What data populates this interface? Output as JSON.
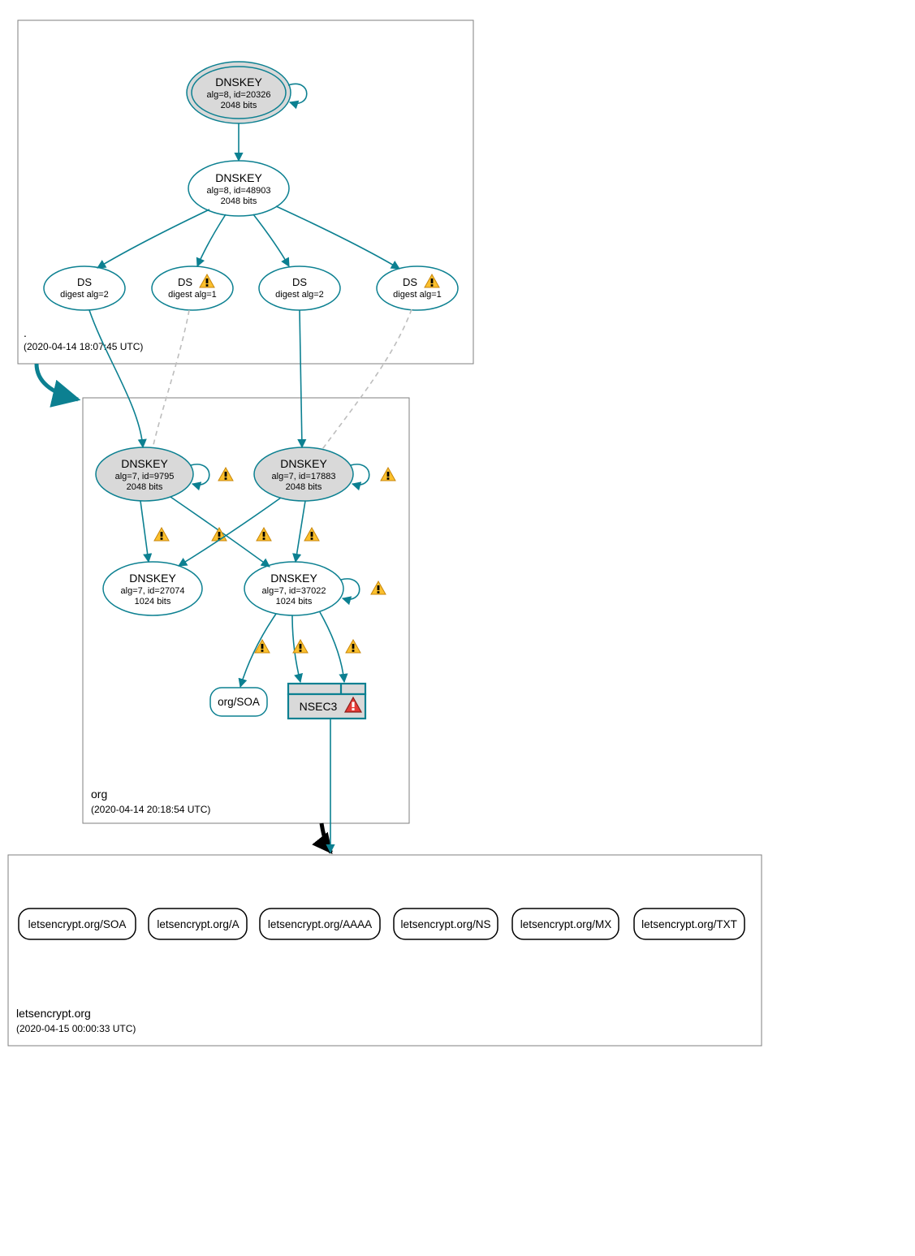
{
  "zones": {
    "root": {
      "name": ".",
      "timestamp": "(2020-04-14 18:07:45 UTC)"
    },
    "org": {
      "name": "org",
      "timestamp": "(2020-04-14 20:18:54 UTC)"
    },
    "le": {
      "name": "letsencrypt.org",
      "timestamp": "(2020-04-15 00:00:33 UTC)"
    }
  },
  "nodes": {
    "root_ksk": {
      "title": "DNSKEY",
      "sub1": "alg=8, id=20326",
      "sub2": "2048 bits"
    },
    "root_zsk": {
      "title": "DNSKEY",
      "sub1": "alg=8, id=48903",
      "sub2": "2048 bits"
    },
    "ds_a": {
      "title": "DS",
      "sub": "digest alg=2"
    },
    "ds_b": {
      "title": "DS",
      "sub": "digest alg=1"
    },
    "ds_c": {
      "title": "DS",
      "sub": "digest alg=2"
    },
    "ds_d": {
      "title": "DS",
      "sub": "digest alg=1"
    },
    "org_ksk1": {
      "title": "DNSKEY",
      "sub1": "alg=7, id=9795",
      "sub2": "2048 bits"
    },
    "org_ksk2": {
      "title": "DNSKEY",
      "sub1": "alg=7, id=17883",
      "sub2": "2048 bits"
    },
    "org_zsk1": {
      "title": "DNSKEY",
      "sub1": "alg=7, id=27074",
      "sub2": "1024 bits"
    },
    "org_zsk2": {
      "title": "DNSKEY",
      "sub1": "alg=7, id=37022",
      "sub2": "1024 bits"
    },
    "org_soa": {
      "label": "org/SOA"
    },
    "nsec3": {
      "label": "NSEC3"
    }
  },
  "records": {
    "le_soa": "letsencrypt.org/SOA",
    "le_a": "letsencrypt.org/A",
    "le_aaaa": "letsencrypt.org/AAAA",
    "le_ns": "letsencrypt.org/NS",
    "le_mx": "letsencrypt.org/MX",
    "le_txt": "letsencrypt.org/TXT"
  }
}
